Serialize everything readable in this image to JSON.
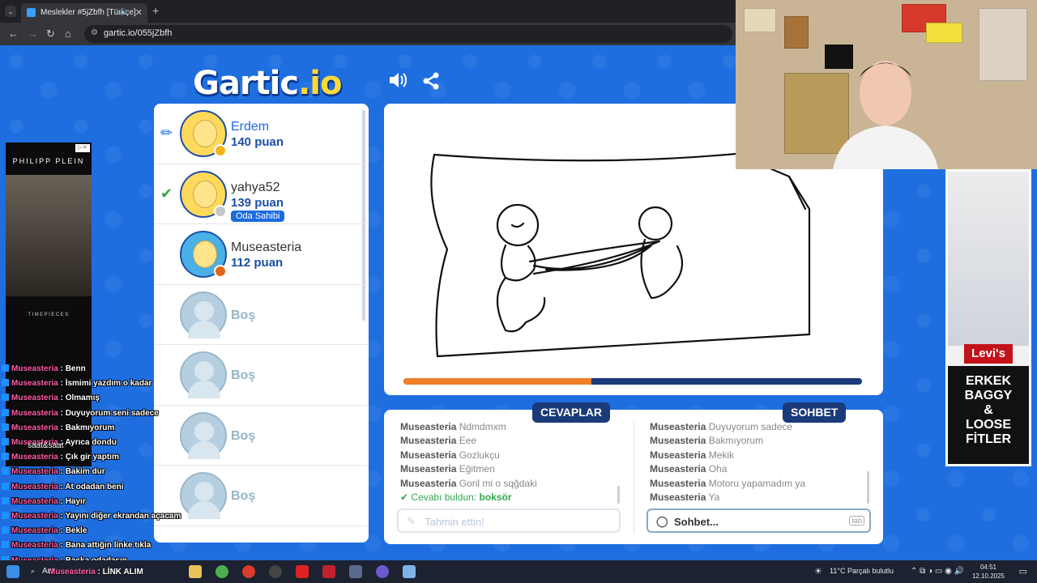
{
  "browser": {
    "tab_title": "Meslekler #5jZbfh [Türkçe]",
    "url": "gartic.io/055jZbfh",
    "new_tab": "+",
    "close": "✕"
  },
  "game": {
    "logo_main": "Gartic",
    "logo_suffix": ".io",
    "players": [
      {
        "name": "Erdem",
        "score": "140 puan",
        "state": "drawing",
        "dot_color": "#f5b41a"
      },
      {
        "name": "yahya52",
        "score": "139 puan",
        "state": "guessed",
        "badge": "Oda Sahibi",
        "dot_color": "#c7c7c7"
      },
      {
        "name": "Museasteria",
        "score": "112 puan",
        "state": "idle",
        "dot_color": "#e0661a"
      },
      {
        "name": "Boş"
      },
      {
        "name": "Boş"
      },
      {
        "name": "Boş"
      },
      {
        "name": "Boş"
      }
    ],
    "progress_fraction": 0.41,
    "answers_label": "CEVAPLAR",
    "chat_label": "SOHBET",
    "answers": [
      {
        "user": "Museasteria",
        "text": "Ndmdmxm"
      },
      {
        "user": "Museasteria",
        "text": "Eee"
      },
      {
        "user": "Museasteria",
        "text": "Gozlukçu"
      },
      {
        "user": "Museasteria",
        "text": "Eğitmen"
      },
      {
        "user": "Museasteria",
        "text": "Goril mi o sqğdaki"
      }
    ],
    "found_prefix": "Cevabı buldun:",
    "found_word": "boksör",
    "chat": [
      {
        "user": "Museasteria",
        "text": "Duyuyorum sadece"
      },
      {
        "user": "Museasteria",
        "text": "Bakmıyorum"
      },
      {
        "user": "Museasteria",
        "text": "Mekik"
      },
      {
        "user": "Museasteria",
        "text": "Oha"
      },
      {
        "user": "Museasteria",
        "text": "Motoru yapamadım ya"
      },
      {
        "user": "Museasteria",
        "text": "Ya"
      }
    ],
    "guess_placeholder": "Tahmin ettin!",
    "chat_placeholder": "Sohbet...",
    "tab_key": "tab"
  },
  "ads": {
    "left_brand": "PHILIPP PLEIN",
    "left_sub": "TIMEPIECES",
    "right_brand": "Levi's",
    "right_copy_1": "ERKEK",
    "right_copy_2": "BAGGY",
    "right_copy_3": "&",
    "right_copy_4": "LOOSE",
    "right_copy_5": "FİTLER"
  },
  "overlay_chat": [
    {
      "user": "Museasteria",
      "text": "Benn"
    },
    {
      "user": "Museasteria",
      "text": "İsmimi yazdım o kadar"
    },
    {
      "user": "Museasteria",
      "text": "Olmamış"
    },
    {
      "user": "Museasteria",
      "text": "Duyuyorum seni sadece"
    },
    {
      "user": "Museasteria",
      "text": "Bakmıyorum"
    },
    {
      "user": "Museasteria",
      "text": "Ayrıca dondu"
    },
    {
      "user": "Museasteria",
      "text": "Çık gir yaptım"
    },
    {
      "user": "Museasteria",
      "text": "Bakim dur"
    },
    {
      "user": "Museasteria",
      "text": "At odadan beni"
    },
    {
      "user": "Museasteria",
      "text": "Hayır"
    },
    {
      "user": "Museasteria",
      "text": "Yayını diğer ekrandan açacam"
    },
    {
      "user": "Museasteria",
      "text": "Bekle"
    },
    {
      "user": "Museasteria",
      "text": "Bana attığın linke tıkla"
    },
    {
      "user": "Museasteria",
      "text": "Başka odadasın"
    },
    {
      "user": "Museasteria",
      "text": "LİNK ALIM"
    }
  ],
  "overlay_watermark": "saat&saat",
  "taskbar": {
    "search": "Ara",
    "weather": "11°C  Parçalı bulutlu",
    "time": "04:51",
    "date": "12.10.2025"
  }
}
